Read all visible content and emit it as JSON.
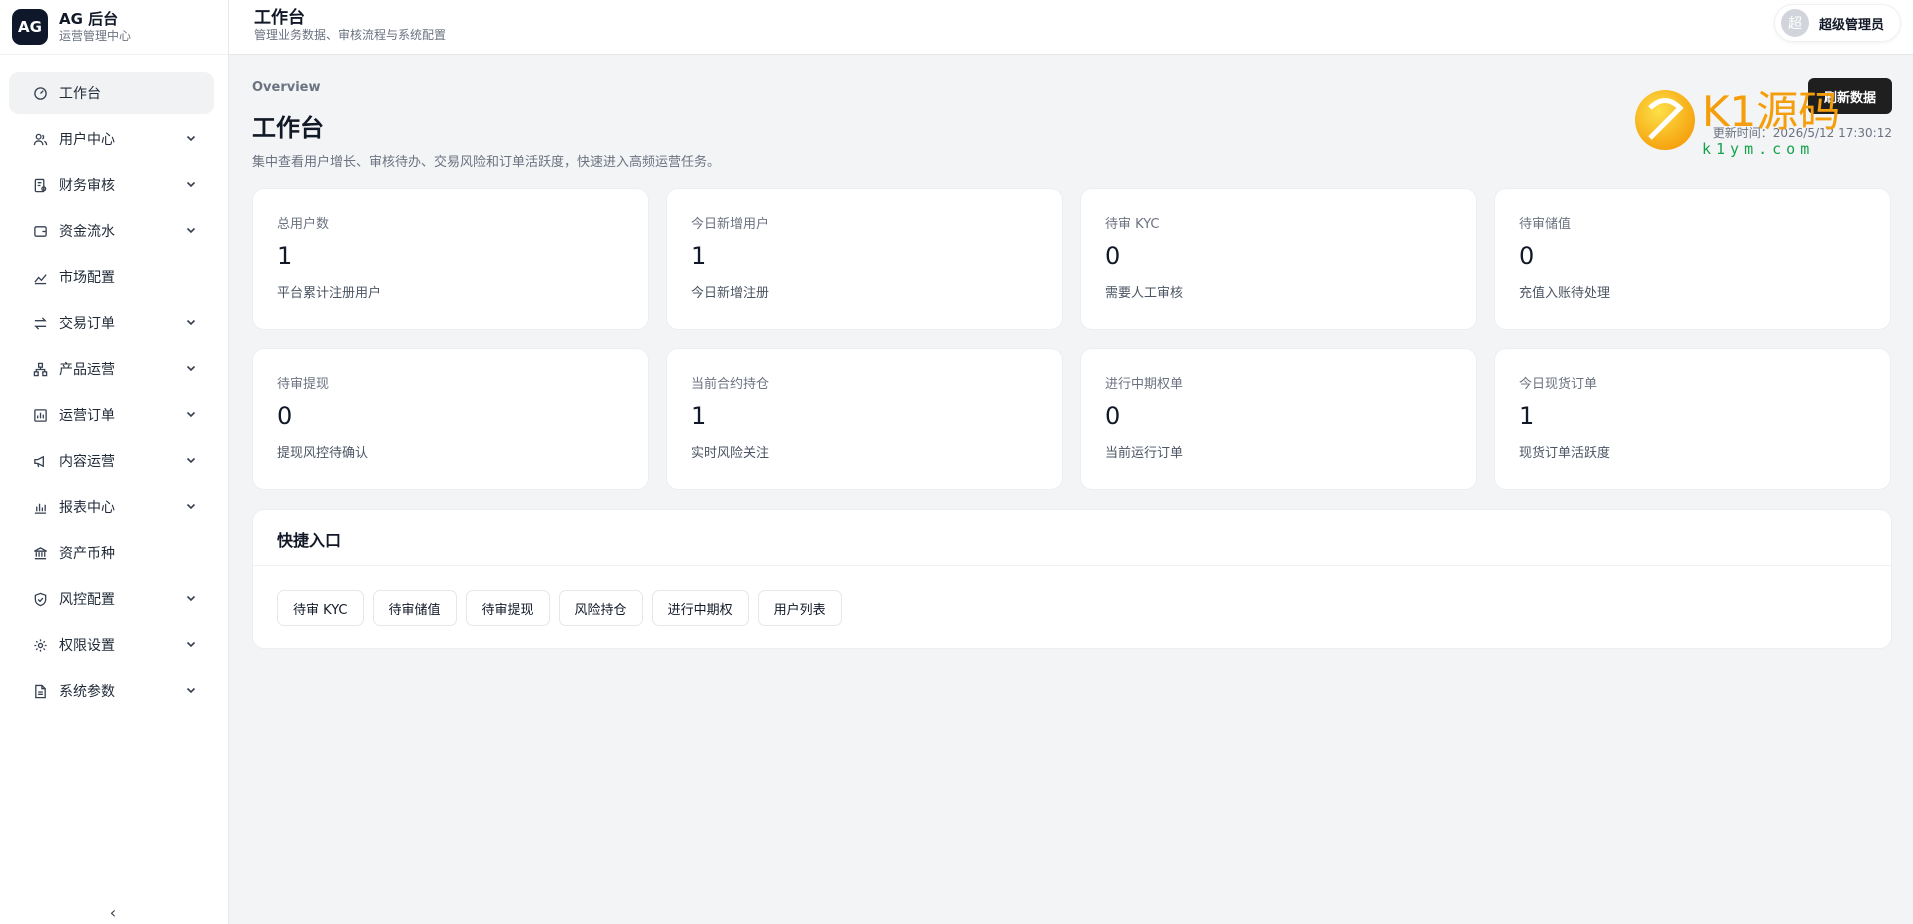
{
  "brand": {
    "logo": "AG",
    "title": "AG 后台",
    "subtitle": "运营管理中心"
  },
  "sidebar": {
    "items": [
      {
        "label": "工作台",
        "icon": "dashboard-icon",
        "active": true,
        "expandable": false
      },
      {
        "label": "用户中心",
        "icon": "users-icon",
        "expandable": true
      },
      {
        "label": "财务审核",
        "icon": "audit-icon",
        "expandable": true
      },
      {
        "label": "资金流水",
        "icon": "wallet-icon",
        "expandable": true
      },
      {
        "label": "市场配置",
        "icon": "trend-icon",
        "expandable": false
      },
      {
        "label": "交易订单",
        "icon": "swap-icon",
        "expandable": true
      },
      {
        "label": "产品运营",
        "icon": "network-icon",
        "expandable": true
      },
      {
        "label": "运营订单",
        "icon": "report-icon",
        "expandable": true
      },
      {
        "label": "内容运营",
        "icon": "megaphone-icon",
        "expandable": true
      },
      {
        "label": "报表中心",
        "icon": "bar-chart-icon",
        "expandable": true
      },
      {
        "label": "资产币种",
        "icon": "bank-icon",
        "expandable": false
      },
      {
        "label": "风控配置",
        "icon": "shield-icon",
        "expandable": true
      },
      {
        "label": "权限设置",
        "icon": "gear-icon",
        "expandable": true
      },
      {
        "label": "系统参数",
        "icon": "file-icon",
        "expandable": true
      }
    ],
    "collapse_label": "‹"
  },
  "header": {
    "title": "工作台",
    "subtitle": "管理业务数据、审核流程与系统配置",
    "user": {
      "avatar": "超",
      "name": "超级管理员"
    }
  },
  "main": {
    "eyebrow": "Overview",
    "title": "工作台",
    "description": "集中查看用户增长、审核待办、交易风险和订单活跃度，快速进入高频运营任务。",
    "refresh_label": "刷新数据",
    "updated": "更新时间：2026/5/12 17:30:12",
    "cards": [
      {
        "label": "总用户数",
        "value": "1",
        "note": "平台累计注册用户"
      },
      {
        "label": "今日新增用户",
        "value": "1",
        "note": "今日新增注册"
      },
      {
        "label": "待审 KYC",
        "value": "0",
        "note": "需要人工审核"
      },
      {
        "label": "待审储值",
        "value": "0",
        "note": "充值入账待处理"
      },
      {
        "label": "待审提现",
        "value": "0",
        "note": "提现风控待确认"
      },
      {
        "label": "当前合约持仓",
        "value": "1",
        "note": "实时风险关注"
      },
      {
        "label": "进行中期权单",
        "value": "0",
        "note": "当前运行订单"
      },
      {
        "label": "今日现货订单",
        "value": "1",
        "note": "现货订单活跃度"
      }
    ],
    "quick": {
      "title": "快捷入口",
      "buttons": [
        "待审 KYC",
        "待审储值",
        "待审提现",
        "风险持仓",
        "进行中期权",
        "用户列表"
      ]
    }
  },
  "watermark": {
    "text": "K1源码",
    "url_text": "k1ym.com"
  },
  "colors": {
    "accent": "#1f1f1f",
    "watermark_orange": "#f59e0b",
    "watermark_green": "#16a34a"
  }
}
